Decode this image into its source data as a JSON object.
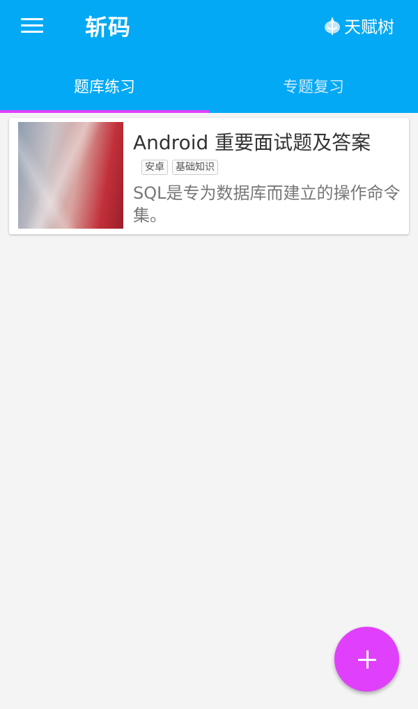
{
  "appbar": {
    "title": "斩码",
    "action_label": "天赋树",
    "action_icon": "tree-icon",
    "menu_icon": "menu-icon",
    "background": "#03a9f4"
  },
  "tabs": [
    {
      "label": "题库练习",
      "active": true
    },
    {
      "label": "专题复习",
      "active": false
    }
  ],
  "tab_indicator_color": "#e040fb",
  "list": [
    {
      "title": "Android 重要面试题及答案",
      "tags": [
        "安卓",
        "基础知识"
      ],
      "description": "SQL是专为数据库而建立的操作命令集。"
    }
  ],
  "fab": {
    "icon": "plus-icon",
    "color": "#e040fb"
  }
}
